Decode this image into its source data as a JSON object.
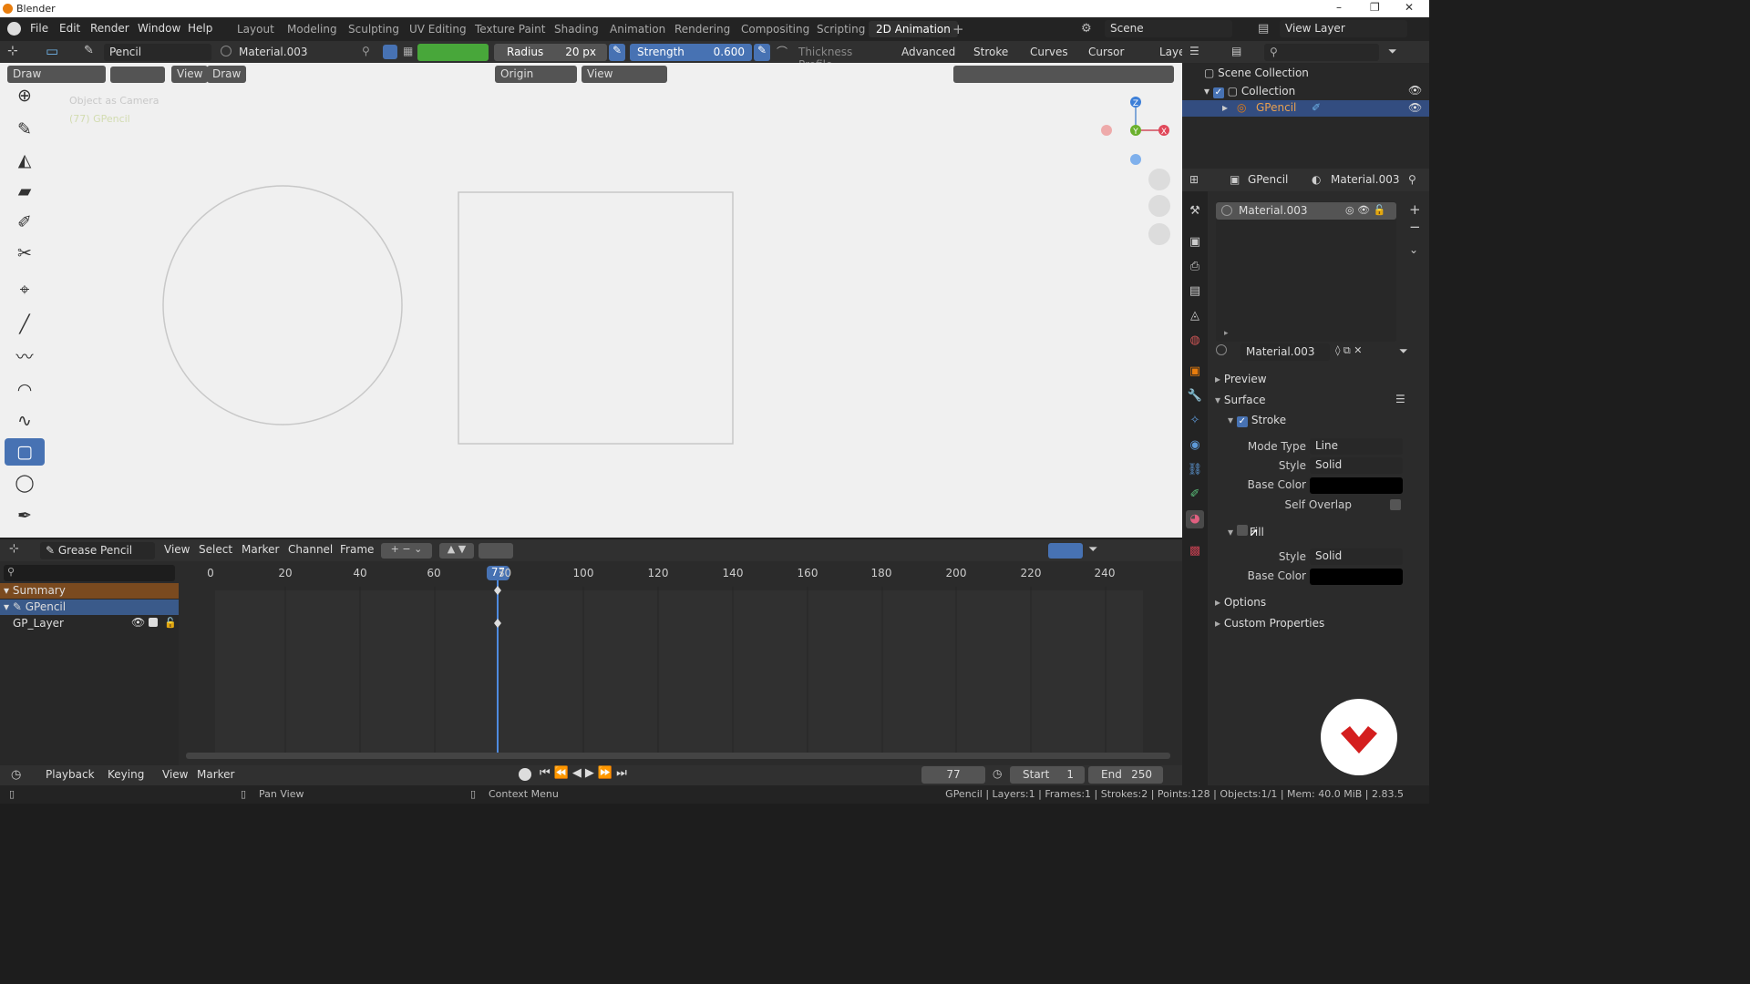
{
  "window": {
    "title": "Blender",
    "controls": [
      "–",
      "❐",
      "✕"
    ]
  },
  "menus": [
    "File",
    "Edit",
    "Render",
    "Window",
    "Help"
  ],
  "workspaces": [
    "Layout",
    "Modeling",
    "Sculpting",
    "UV Editing",
    "Texture Paint",
    "Shading",
    "Animation",
    "Rendering",
    "Compositing",
    "Scripting",
    "2D Animation"
  ],
  "active_workspace": "2D Animation",
  "scene": {
    "label": "Scene",
    "view_layer": "View Layer"
  },
  "tool_header": {
    "brush": "Pencil",
    "material": "Material.003",
    "radius_label": "Radius",
    "radius_value": "20 px",
    "strength_label": "Strength",
    "strength_value": "0.600",
    "thickness_profile": "Thickness Profile",
    "advanced": "Advanced",
    "stroke": "Stroke",
    "curves": "Curves",
    "cursor": "Cursor",
    "layer_partial": "Laye"
  },
  "viewport_header": {
    "mode": "Draw",
    "view": "View",
    "draw": "Draw",
    "origin": "Origin",
    "view_dd": "View"
  },
  "viewport": {
    "overlay_line1": "Object as Camera",
    "overlay_line2": "(77) GPencil"
  },
  "dopesheet": {
    "mode": "Grease Pencil",
    "menus": [
      "View",
      "Select",
      "Marker",
      "Channel",
      "Frame"
    ],
    "ticks": [
      "0",
      "20",
      "40",
      "60",
      "80",
      "100",
      "120",
      "140",
      "160",
      "180",
      "200",
      "220",
      "240"
    ],
    "current_frame": "77",
    "channels": {
      "summary": "Summary",
      "object": "GPencil",
      "layer": "GP_Layer"
    }
  },
  "timeline": {
    "playback": "Playback",
    "keying": "Keying",
    "view": "View",
    "marker": "Marker",
    "frame": "77",
    "start_label": "Start",
    "start": "1",
    "end_label": "End",
    "end": "250"
  },
  "outliner": {
    "scene_collection": "Scene Collection",
    "collection": "Collection",
    "object": "GPencil"
  },
  "properties": {
    "object": "GPencil",
    "material": "Material.003",
    "slot": "Material.003",
    "data_name": "Material.003",
    "preview": "Preview",
    "surface": "Surface",
    "stroke": "Stroke",
    "mode_type_label": "Mode Type",
    "mode_type": "Line",
    "style_label": "Style",
    "style": "Solid",
    "base_color_label": "Base Color",
    "self_overlap_label": "Self Overlap",
    "fill": "Fill",
    "fill_style_label": "Style",
    "fill_style": "Solid",
    "fill_base_color_label": "Base Color",
    "options": "Options",
    "custom_properties": "Custom Properties"
  },
  "status": {
    "pan": "Pan View",
    "context": "Context Menu",
    "info": "GPencil | Layers:1 | Frames:1 | Strokes:2 | Points:128 | Objects:1/1 | Mem: 40.0 MiB | 2.83.5"
  },
  "colors": {
    "accent": "#4772b3",
    "selected_orange": "#e87d0d",
    "summary_bg": "#7a4a1f"
  }
}
